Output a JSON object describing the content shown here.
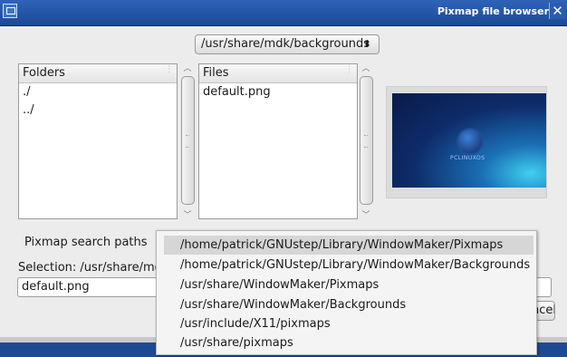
{
  "window": {
    "title": "Pixmap file browser",
    "close_glyph": "✕"
  },
  "directory_select": {
    "value": "/usr/share/mdk/backgrounds",
    "arrows": "⬍"
  },
  "folders": {
    "header": "Folders",
    "items": [
      "./",
      "../"
    ]
  },
  "files": {
    "header": "Files",
    "items": [
      "default.png"
    ]
  },
  "preview": {
    "brand": "PCLINUXOS"
  },
  "search_paths_label": "Pixmap search paths",
  "selection": {
    "label": "Selection: /usr/share/mdk",
    "value": "default.png"
  },
  "cancel_label": "Cancel",
  "search_paths": [
    "/home/patrick/GNUstep/Library/WindowMaker/Pixmaps",
    "/home/patrick/GNUstep/Library/WindowMaker/Backgrounds",
    "/usr/share/WindowMaker/Pixmaps",
    "/usr/share/WindowMaker/Backgrounds",
    "/usr/include/X11/pixmaps",
    "/usr/share/pixmaps"
  ],
  "colors": {
    "titlebar": "#1b4a96",
    "highlight": "#d6d6d6"
  }
}
